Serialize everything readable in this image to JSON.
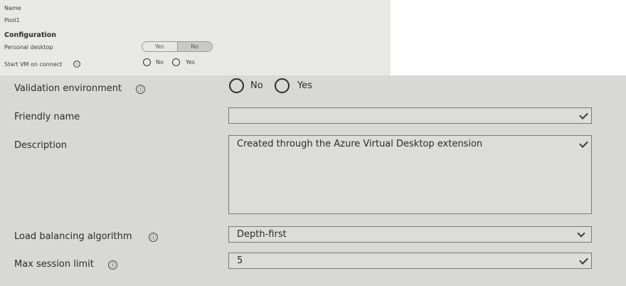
{
  "summary": {
    "name_label": "Name",
    "name_value": "Pool1",
    "configuration_heading": "Configuration",
    "personal_desktop_label": "Personal desktop",
    "personal_desktop_options": [
      "Yes",
      "No"
    ],
    "personal_desktop_selected": "No",
    "start_vm_label": "Start VM on connect",
    "start_vm_options": [
      "No",
      "Yes"
    ],
    "start_vm_selected": "No"
  },
  "form": {
    "validation_label": "Validation environment",
    "validation_options": [
      "No",
      "Yes"
    ],
    "validation_selected": "No",
    "friendly_name_label": "Friendly name",
    "friendly_name_value": "",
    "description_label": "Description",
    "description_value": "Created through the Azure Virtual Desktop extension",
    "load_balancing_label": "Load balancing algorithm",
    "load_balancing_value": "Depth-first",
    "max_session_label": "Max session limit",
    "max_session_value": "5"
  },
  "icons": {
    "info": "ⓘ"
  },
  "colors": {
    "top_panel_bg": "#e8e8e6",
    "form_panel_bg": "#d8d8d6",
    "field_border": "#7a7a7a"
  }
}
